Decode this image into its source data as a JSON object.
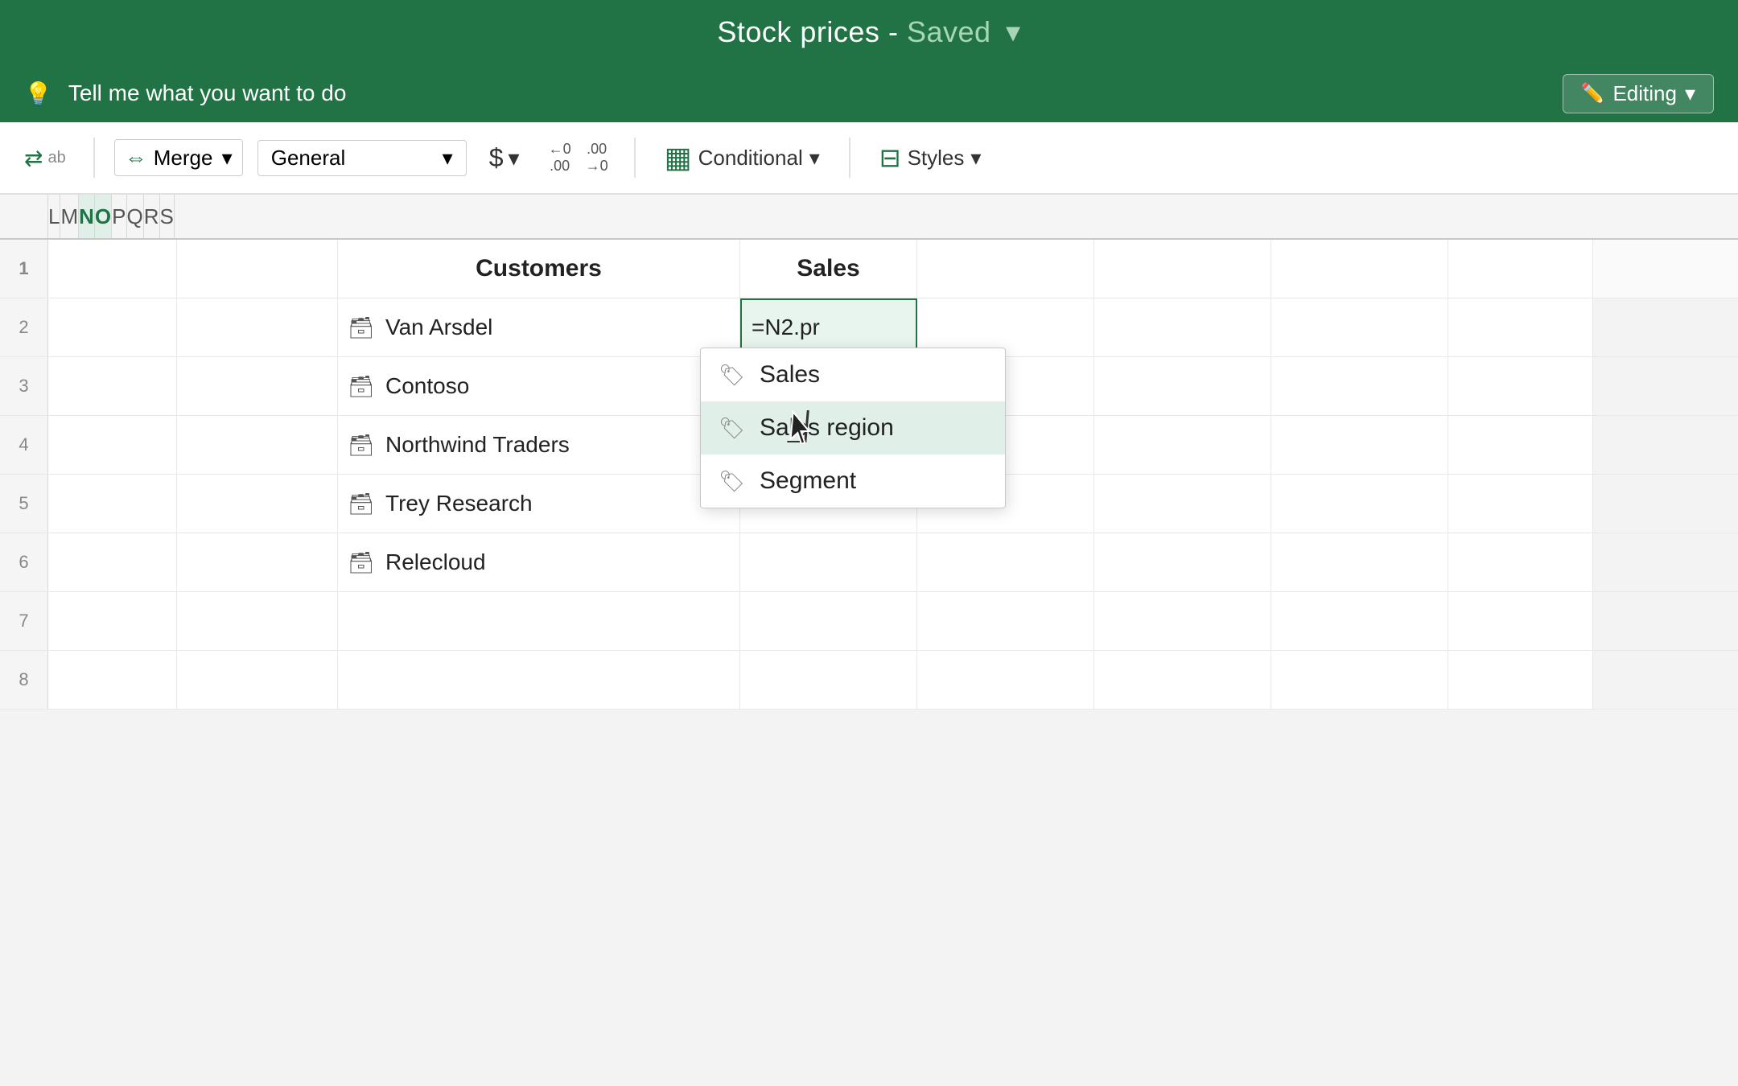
{
  "titleBar": {
    "title": "Stock prices",
    "savedText": "Saved",
    "chevron": "▾"
  },
  "tellMeBar": {
    "iconSymbol": "💡",
    "placeholder": "Tell me what you want to do",
    "editingButton": {
      "icon": "✏️",
      "label": "Editing",
      "chevron": "▾"
    }
  },
  "ribbon": {
    "wrapIcon": "⇄",
    "mergeLabel": "Merge",
    "mergeChevron": "▾",
    "formatLabel": "General",
    "formatChevron": "▾",
    "dollarLabel": "$",
    "dollarChevron": "▾",
    "decreaseDecimal": "←0\n.00",
    "increaseDecimal": ".00\n→0",
    "conditionalIcon": "▦",
    "conditionalLabel": "Conditional",
    "conditionalChevron": "▾",
    "stylesIcon": "⊟",
    "stylesLabel": "Styles",
    "stylesChevron": "▾"
  },
  "columns": {
    "headers": [
      "L",
      "M",
      "N",
      "O",
      "P",
      "Q",
      "R",
      "S"
    ]
  },
  "rows": {
    "headerRow": {
      "customers": "Customers",
      "sales": "Sales"
    },
    "dataRows": [
      {
        "icon": "🗃",
        "name": "Van Arsdel",
        "formula": "=N2.pr"
      },
      {
        "icon": "🗃",
        "name": "Contoso",
        "formula": ""
      },
      {
        "icon": "🗃",
        "name": "Northwind Traders",
        "formula": ""
      },
      {
        "icon": "🗃",
        "name": "Trey Research",
        "formula": ""
      },
      {
        "icon": "🗃",
        "name": "Relecloud",
        "formula": ""
      }
    ]
  },
  "autocomplete": {
    "items": [
      {
        "icon": "🏷",
        "label": "Sales"
      },
      {
        "icon": "🏷",
        "label": "Sales region"
      },
      {
        "icon": "🏷",
        "label": "Segment"
      }
    ],
    "highlightedIndex": 1
  }
}
